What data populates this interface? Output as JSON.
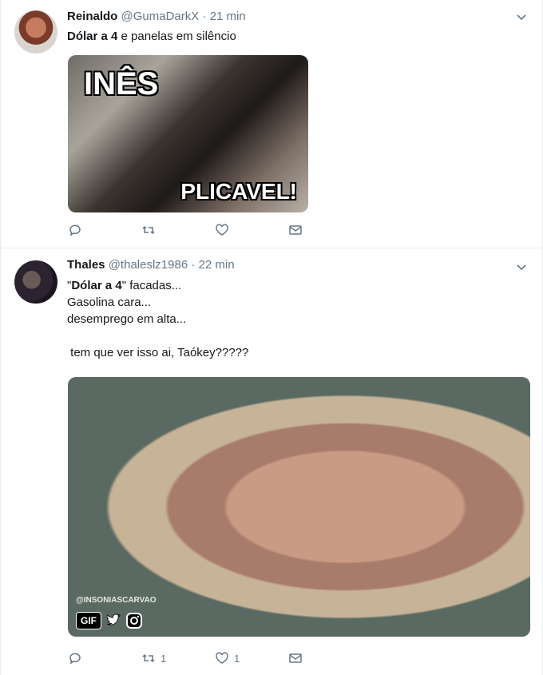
{
  "tweets": [
    {
      "name": "Reinaldo",
      "handle": "@GumaDarkX",
      "dot": "·",
      "time": "21 min",
      "text_bold": "Dólar a 4",
      "text_rest": " e panelas em silêncio",
      "media": {
        "caption_top": "INÊS",
        "caption_bottom": "PLICAVEL!"
      },
      "actions": {
        "reply": "",
        "retweet": "",
        "like": "",
        "dm": ""
      }
    },
    {
      "name": "Thales",
      "handle": "@thaleslz1986",
      "dot": "·",
      "time": "22 min",
      "text_line1_quote_open": "\"",
      "text_line1_bold": "Dólar a 4",
      "text_line1_rest": "\" facadas...",
      "text_line2": "Gasolina cara...",
      "text_line3": "desemprego em alta...",
      "text_line5": " tem que ver isso ai, Taókey?????",
      "media": {
        "watermark": "@INSONIASCARVAO",
        "badge": "GIF"
      },
      "actions": {
        "reply": "",
        "retweet": "1",
        "like": "1",
        "dm": ""
      }
    }
  ],
  "icons": [
    "avatar",
    "chevron-down-icon",
    "reply-icon",
    "retweet-icon",
    "like-icon",
    "dm-icon",
    "twitter-bird-icon",
    "instagram-icon"
  ],
  "colors": {
    "text": "#14171a",
    "muted": "#657786",
    "divider": "#e6ecf0"
  }
}
